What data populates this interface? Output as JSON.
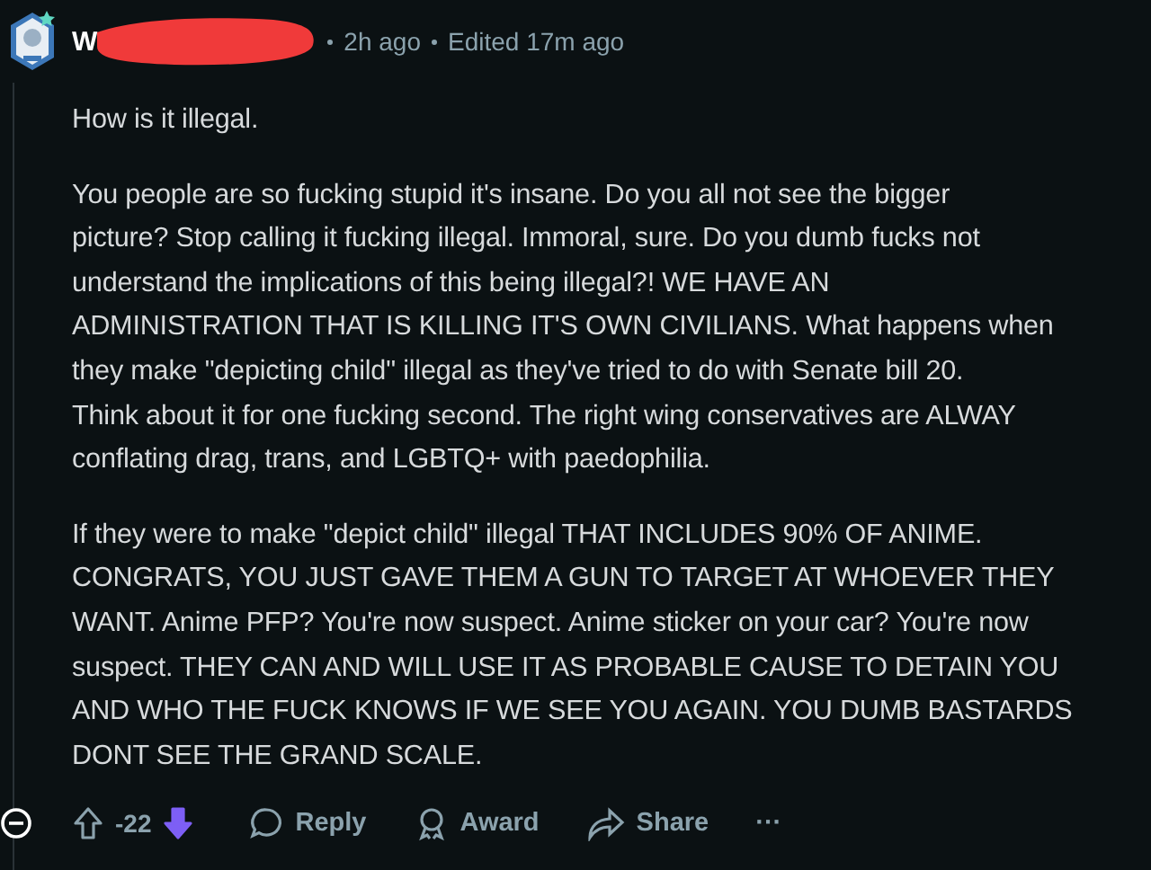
{
  "comment": {
    "author": "W",
    "time": "2h ago",
    "edited": "Edited 17m ago",
    "paragraphs": [
      [
        "How is it illegal."
      ],
      [
        "You people are so fucking stupid it's insane. Do you all not see the bigger",
        "picture? Stop calling it fucking illegal. Immoral, sure. Do you dumb fucks not",
        "understand the implications of this being illegal?! WE HAVE AN",
        "ADMINISTRATION THAT IS KILLING IT'S OWN CIVILIANS. What happens when",
        "they make \"depicting child\" illegal as they've tried to do with Senate bill 20.",
        "Think about it for one fucking second. The right wing conservatives are ALWAY",
        "conflating drag, trans, and LGBTQ+ with paedophilia."
      ],
      [
        "If they were to make \"depict child\" illegal THAT INCLUDES 90% OF ANIME.",
        "CONGRATS, YOU JUST GAVE THEM A GUN TO TARGET AT WHOEVER THEY",
        "WANT. Anime PFP? You're now suspect. Anime sticker on your car? You're now",
        "suspect. THEY CAN AND WILL USE IT AS PROBABLE CAUSE TO DETAIN YOU",
        "AND WHO THE FUCK KNOWS IF WE SEE YOU AGAIN. YOU DUMB BASTARDS",
        "DONT SEE THE GRAND SCALE."
      ]
    ],
    "score": "-22",
    "upvoted": false,
    "downvoted": true,
    "expanded": true,
    "actions": [
      {
        "kind": "reply",
        "label": "Reply"
      },
      {
        "kind": "award",
        "label": "Award"
      },
      {
        "kind": "share",
        "label": "Share"
      },
      {
        "kind": "more",
        "label": "···"
      }
    ]
  }
}
